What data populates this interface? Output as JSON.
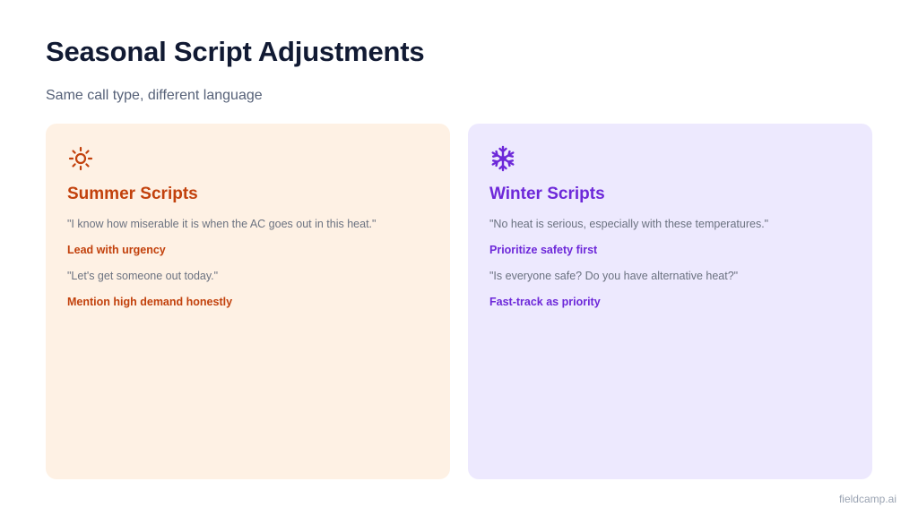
{
  "title": "Seasonal Script Adjustments",
  "subtitle": "Same call type, different language",
  "colors": {
    "summer_accent": "#c2410c",
    "summer_bg": "#fef1e4",
    "winter_accent": "#6d28d9",
    "winter_bg": "#ede9fe"
  },
  "summer": {
    "icon": "sun-icon",
    "title": "Summer Scripts",
    "quote1": "\"I know how miserable it is when the AC goes out in this heat.\"",
    "tip1": "Lead with urgency",
    "quote2": "\"Let's get someone out today.\"",
    "tip2": "Mention high demand honestly"
  },
  "winter": {
    "icon": "snowflake-icon",
    "title": "Winter Scripts",
    "quote1": "\"No heat is serious, especially with these temperatures.\"",
    "tip1": "Prioritize safety first",
    "quote2": "\"Is everyone safe? Do you have alternative heat?\"",
    "tip2": "Fast-track as priority"
  },
  "brand": "fieldcamp.ai"
}
